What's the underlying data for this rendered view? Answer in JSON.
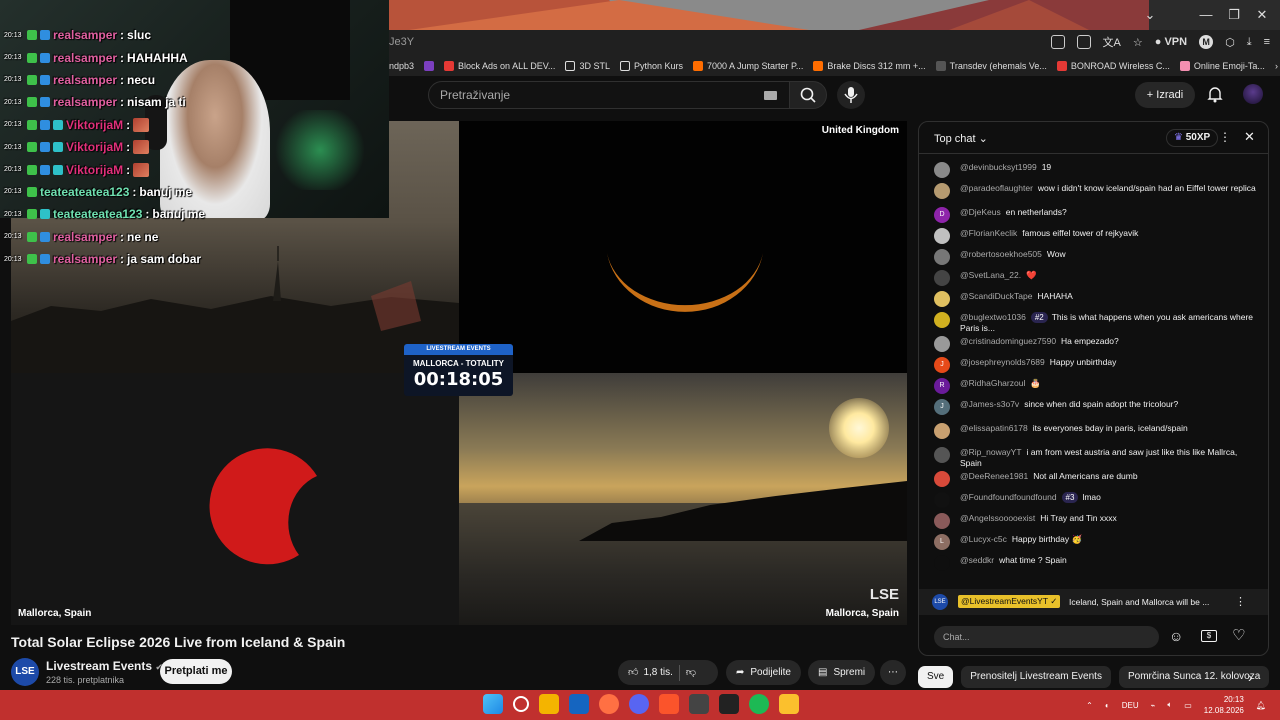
{
  "browser": {
    "url_fragment": "Je3Y",
    "vpn_label": "VPN",
    "profile_initial": "M",
    "bookmarks": [
      "ndpb3",
      "Block Ads on ALL DEV...",
      "3D STL",
      "Python Kurs",
      "7000 A Jump Starter P...",
      "Brake Discs 312 mm +...",
      "Transdev (ehemals Ve...",
      "BONROAD Wireless C...",
      "Online Emoji-Ta..."
    ]
  },
  "youtube": {
    "search_placeholder": "Pretraživanje",
    "create_label": "Izradi"
  },
  "video": {
    "label_top_right": "United Kingdom",
    "label_bottom_left": "Mallorca, Spain",
    "label_bottom_right": "Mallorca, Spain",
    "watermark": "LSE",
    "timer_header": "LIVESTREAM EVENTS",
    "timer_title": "MALLORCA - TOTALITY",
    "timer_value": "00:18:05"
  },
  "twitch_chat": [
    {
      "time": "20:13",
      "user": "realsamper",
      "color": "#e060a0",
      "badges": [
        "green",
        "blue"
      ],
      "msg": "sluc"
    },
    {
      "time": "20:13",
      "user": "realsamper",
      "color": "#e060a0",
      "badges": [
        "green",
        "blue"
      ],
      "msg": "HAHAHHA"
    },
    {
      "time": "20:13",
      "user": "realsamper",
      "color": "#e060a0",
      "badges": [
        "green",
        "blue"
      ],
      "msg": "necu"
    },
    {
      "time": "20:13",
      "user": "realsamper",
      "color": "#e060a0",
      "badges": [
        "green",
        "blue"
      ],
      "msg": "nisam ja ti"
    },
    {
      "time": "20:13",
      "user": "ViktorijaM",
      "color": "#e0307a",
      "badges": [
        "green",
        "blue",
        "teal"
      ],
      "msg": "",
      "emote": true
    },
    {
      "time": "20:13",
      "user": "ViktorijaM",
      "color": "#e0307a",
      "badges": [
        "green",
        "blue",
        "teal"
      ],
      "msg": "",
      "emote": true
    },
    {
      "time": "20:13",
      "user": "ViktorijaM",
      "color": "#e0307a",
      "badges": [
        "green",
        "blue",
        "teal"
      ],
      "msg": "",
      "emote": true
    },
    {
      "time": "20:13",
      "user": "teateateatea123",
      "color": "#6fe0b0",
      "badges": [
        "green"
      ],
      "msg": "banuj me"
    },
    {
      "time": "20:13",
      "user": "teateateatea123",
      "color": "#6fe0b0",
      "badges": [
        "green",
        "teal"
      ],
      "msg": "banuj me"
    },
    {
      "time": "20:13",
      "user": "realsamper",
      "color": "#e060a0",
      "badges": [
        "green",
        "blue"
      ],
      "msg": "ne ne"
    },
    {
      "time": "20:13",
      "user": "realsamper",
      "color": "#e060a0",
      "badges": [
        "green",
        "blue"
      ],
      "msg": "ja sam dobar"
    }
  ],
  "below_video": {
    "title": "Total Solar Eclipse 2026 Live from Iceland & Spain",
    "channel_avatar": "LSE",
    "channel_name": "Livestream Events",
    "subscribers": "228 tis. pretplatnika",
    "subscribe_label": "Pretplati me",
    "likes": "1,8 tis.",
    "share_label": "Podijelite",
    "save_label": "Spremi",
    "more_label": "⋯"
  },
  "live_chat": {
    "title": "Top chat",
    "xp": "50XP",
    "messages": [
      {
        "author": "@devinbucksyt1999",
        "text": "19",
        "av": "",
        "avc": "#8a8a8a"
      },
      {
        "author": "@paradeoflaughter",
        "text": "wow i didn't know iceland/spain had an Eiffel tower replica",
        "av": "",
        "avc": "#b59a70"
      },
      {
        "author": "@DjeKeus",
        "text": "en netherlands?",
        "av": "D",
        "avc": "#8e24aa"
      },
      {
        "author": "@FlorianKeclik",
        "text": "famous eiffel tower of rejkyavik",
        "av": "",
        "avc": "#c0c0c0"
      },
      {
        "author": "@robertosoekhoe505",
        "text": "Wow",
        "av": "",
        "avc": "#777"
      },
      {
        "author": "@SvetLana_22.",
        "text": "❤️",
        "av": "",
        "avc": "#444"
      },
      {
        "author": "@ScandiDuckTape",
        "text": "HAHAHA",
        "av": "",
        "avc": "#e0c060"
      },
      {
        "author": "@buglextwo1036",
        "rank": "#2",
        "text": "This is what happens when you ask americans where Paris is...",
        "av": "",
        "avc": "#d0b020"
      },
      {
        "author": "@cristinadominguez7590",
        "text": "Ha empezado?",
        "av": "",
        "avc": "#999"
      },
      {
        "author": "@josephreynolds7689",
        "text": "Happy unbirthday",
        "av": "J",
        "avc": "#e64a19"
      },
      {
        "author": "@RidhaGharzoul",
        "text": "🎂",
        "av": "R",
        "avc": "#6a1b9a"
      },
      {
        "author": "@James-s3o7v",
        "text": "since when did spain adopt the tricolour?",
        "av": "J",
        "avc": "#546e7a"
      },
      {
        "author": "@elissapatin6178",
        "text": "its everyones bday in paris, iceland/spain",
        "av": "",
        "avc": "#c8a070"
      },
      {
        "author": "@Rip_nowayYT",
        "text": "i am from west austria and saw just like this like Mallrca, Spain",
        "av": "",
        "avc": "#555"
      },
      {
        "author": "@DeeRenee1981",
        "text": "Not all Americans are dumb",
        "av": "",
        "avc": "#d84a3a"
      },
      {
        "author": "@Foundfoundfoundfound",
        "rank": "#3",
        "text": "lmao",
        "av": "",
        "avc": "#111"
      },
      {
        "author": "@Angelssooooexist",
        "text": "Hi Tray and Tin xxxx",
        "av": "",
        "avc": "#8a5a5a"
      },
      {
        "author": "@Lucyx-c5c",
        "text": "Happy birthday 🥳",
        "av": "L",
        "avc": "#8d6e63"
      },
      {
        "author": "@seddkr",
        "text": "what time ? Spain",
        "av": "",
        "avc": "#0f0f0f"
      }
    ],
    "pinned_author": "@LivestreamEventsYT ✓",
    "pinned_text": "Iceland, Spain and Mallorca will be ...",
    "pinned_avatar": "LSE",
    "input_placeholder": "Chat..."
  },
  "chips": [
    "Sve",
    "Prenositelj Livestream Events",
    "Pomrčina Sunca 12. kolovoza"
  ],
  "taskbar": {
    "lang": "DEU",
    "time": "20:13",
    "date": "12.08.2026",
    "icon_colors": [
      "#1e88e5",
      "#ffffff",
      "#f4b400",
      "#1565c0",
      "#ff7043",
      "#5865f2",
      "#fb542b",
      "#444444",
      "#222222",
      "#1db954",
      "#fbc02d"
    ]
  }
}
